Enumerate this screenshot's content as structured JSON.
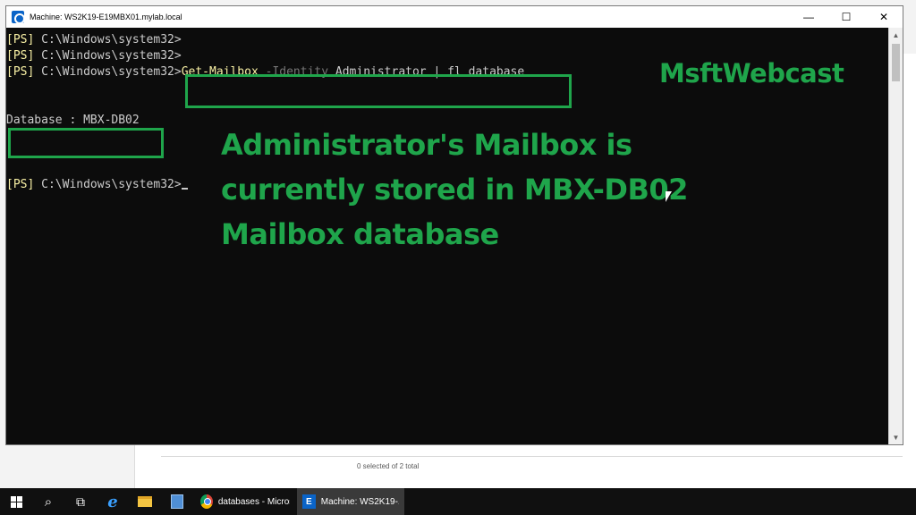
{
  "window": {
    "title": "Machine: WS2K19-E19MBX01.mylab.local",
    "minimize": "—",
    "maximize": "☐",
    "close": "✕"
  },
  "console": {
    "prompt_tag": "[PS]",
    "path": " C:\\Windows\\system32>",
    "path_short": " C:\\Windows\\system32",
    "prompt_gt": ">",
    "command": {
      "name": "Get-Mailbox",
      "param": " -Identity",
      "arg": " Administrator | fl database"
    },
    "output": "Database : MBX-DB02"
  },
  "overlay": {
    "brand": "MsftWebcast",
    "message": "Administrator's Mailbox is currently stored in MBX-DB02 Mailbox database"
  },
  "background_app": {
    "status": "0 selected of 2 total"
  },
  "taskbar": {
    "items": [
      {
        "label": "databases - Micros..."
      },
      {
        "label": "Machine: WS2K19-..."
      }
    ]
  },
  "colors": {
    "accent_green": "#1fa54b",
    "console_bg": "#0c0c0c",
    "prompt_yellow": "#f9f1a5",
    "param_gray": "#767676"
  }
}
